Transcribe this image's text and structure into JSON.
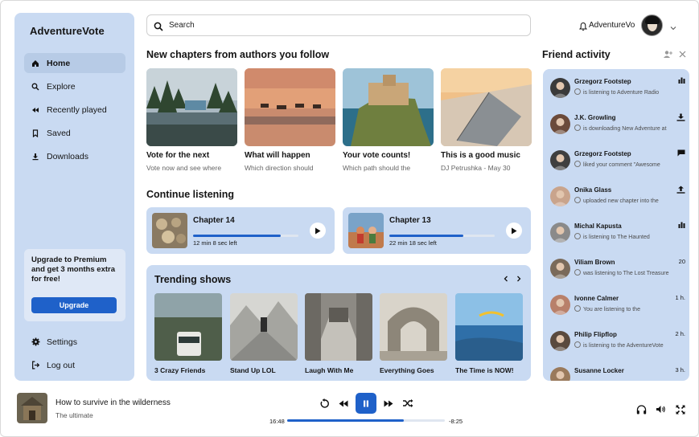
{
  "app": {
    "brand": "AdventureVote"
  },
  "sidebar": {
    "items": [
      {
        "label": "Home",
        "icon": "home-icon",
        "active": true
      },
      {
        "label": "Explore",
        "icon": "search-icon"
      },
      {
        "label": "Recently played",
        "icon": "rewind-icon"
      },
      {
        "label": "Saved",
        "icon": "bookmark-icon"
      },
      {
        "label": "Downloads",
        "icon": "download-icon"
      }
    ],
    "promo": {
      "text": "Upgrade to Premium and get 3 months extra for free!",
      "button": "Upgrade"
    },
    "bottom": [
      {
        "label": "Settings",
        "icon": "gear-icon"
      },
      {
        "label": "Log out",
        "icon": "logout-icon"
      }
    ]
  },
  "search": {
    "placeholder": "Search"
  },
  "user": {
    "name": "AdventureVo"
  },
  "new_chapters": {
    "title": "New chapters from authors you follow",
    "items": [
      {
        "title": "Vote for the next",
        "subtitle": "Vote now and see where"
      },
      {
        "title": "What will happen",
        "subtitle": "Which direction should"
      },
      {
        "title": "Your vote counts!",
        "subtitle": "Which path should the"
      },
      {
        "title": "This is a good music",
        "subtitle": "DJ Petrushka - May 30"
      }
    ]
  },
  "continue": {
    "title": "Continue listening",
    "items": [
      {
        "title": "Chapter 14",
        "left": "12 min 8 sec left",
        "progress": 0.83
      },
      {
        "title": "Chapter 13",
        "left": "22 min 18 sec left",
        "progress": 0.7
      }
    ]
  },
  "trending": {
    "title": "Trending shows",
    "items": [
      {
        "title": "3 Crazy Friends"
      },
      {
        "title": "Stand Up LOL"
      },
      {
        "title": "Laugh With Me"
      },
      {
        "title": "Everything Goes"
      },
      {
        "title": "The Time is NOW!"
      }
    ]
  },
  "friends": {
    "title": "Friend activity",
    "items": [
      {
        "name": "Grzegorz Footstep",
        "desc": "is listening to Adventure Radio",
        "right": "",
        "icon": "bars-icon"
      },
      {
        "name": "J.K. Growling",
        "desc": "is downloading New Adventure at",
        "right": "",
        "icon": "download-icon"
      },
      {
        "name": "Grzegorz Footstep",
        "desc": "liked your comment \"Awesome",
        "right": "",
        "icon": "comment-icon"
      },
      {
        "name": "Onika Glass",
        "desc": "uploaded new chapter into the",
        "right": "",
        "icon": "upload-icon"
      },
      {
        "name": "Michal Kapusta",
        "desc": "is listening to The Haunted",
        "right": "",
        "icon": "bars-icon"
      },
      {
        "name": "Viliam Brown",
        "desc": "was listening to The Lost Treasure",
        "right": "20",
        "icon": ""
      },
      {
        "name": "Ivonne Calmer",
        "desc": "You are listening to the",
        "right": "1 h.",
        "icon": ""
      },
      {
        "name": "Philip Flipflop",
        "desc": "is listening to the AdventureVote",
        "right": "2 h.",
        "icon": ""
      },
      {
        "name": "Susanne Locker",
        "desc": "",
        "right": "3 h.",
        "icon": ""
      }
    ]
  },
  "player": {
    "title": "How to survive in the wilderness",
    "subtitle": "The ultimate",
    "elapsed": "16:48",
    "remaining": "-8:25",
    "progress": 0.74
  },
  "colors": {
    "accent": "#1f61c9",
    "panel": "#c9daf2"
  }
}
